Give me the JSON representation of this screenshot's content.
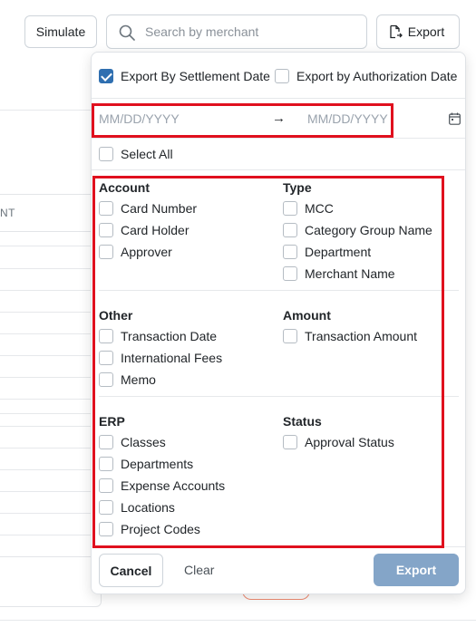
{
  "toolbar": {
    "simulate_label": "Simulate",
    "search_placeholder": "Search by merchant",
    "export_label": "Export"
  },
  "background": {
    "column_header": "NT"
  },
  "export_panel": {
    "export_by_settlement": {
      "label": "Export By Settlement Date",
      "checked": true
    },
    "export_by_authorization": {
      "label": "Export by Authorization Date",
      "checked": false
    },
    "date_range": {
      "start_placeholder": "MM/DD/YYYY",
      "arrow": "→",
      "end_placeholder": "MM/DD/YYYY"
    },
    "select_all_label": "Select All",
    "groups": {
      "account": {
        "title": "Account",
        "items": [
          "Card Number",
          "Card Holder",
          "Approver"
        ]
      },
      "type": {
        "title": "Type",
        "items": [
          "MCC",
          "Category Group Name",
          "Department",
          "Merchant Name"
        ]
      },
      "other": {
        "title": "Other",
        "items": [
          "Transaction Date",
          "International Fees",
          "Memo"
        ]
      },
      "amount": {
        "title": "Amount",
        "items": [
          "Transaction Amount"
        ]
      },
      "erp": {
        "title": "ERP",
        "items": [
          "Classes",
          "Departments",
          "Expense Accounts",
          "Locations",
          "Project Codes"
        ]
      },
      "status": {
        "title": "Status",
        "items": [
          "Approval Status"
        ]
      }
    },
    "footer": {
      "cancel_label": "Cancel",
      "clear_label": "Clear",
      "export_label": "Export"
    }
  },
  "colors": {
    "accent": "#2f6fb0",
    "highlight_red": "#e0101e",
    "export_disabled": "#84a5c8"
  }
}
